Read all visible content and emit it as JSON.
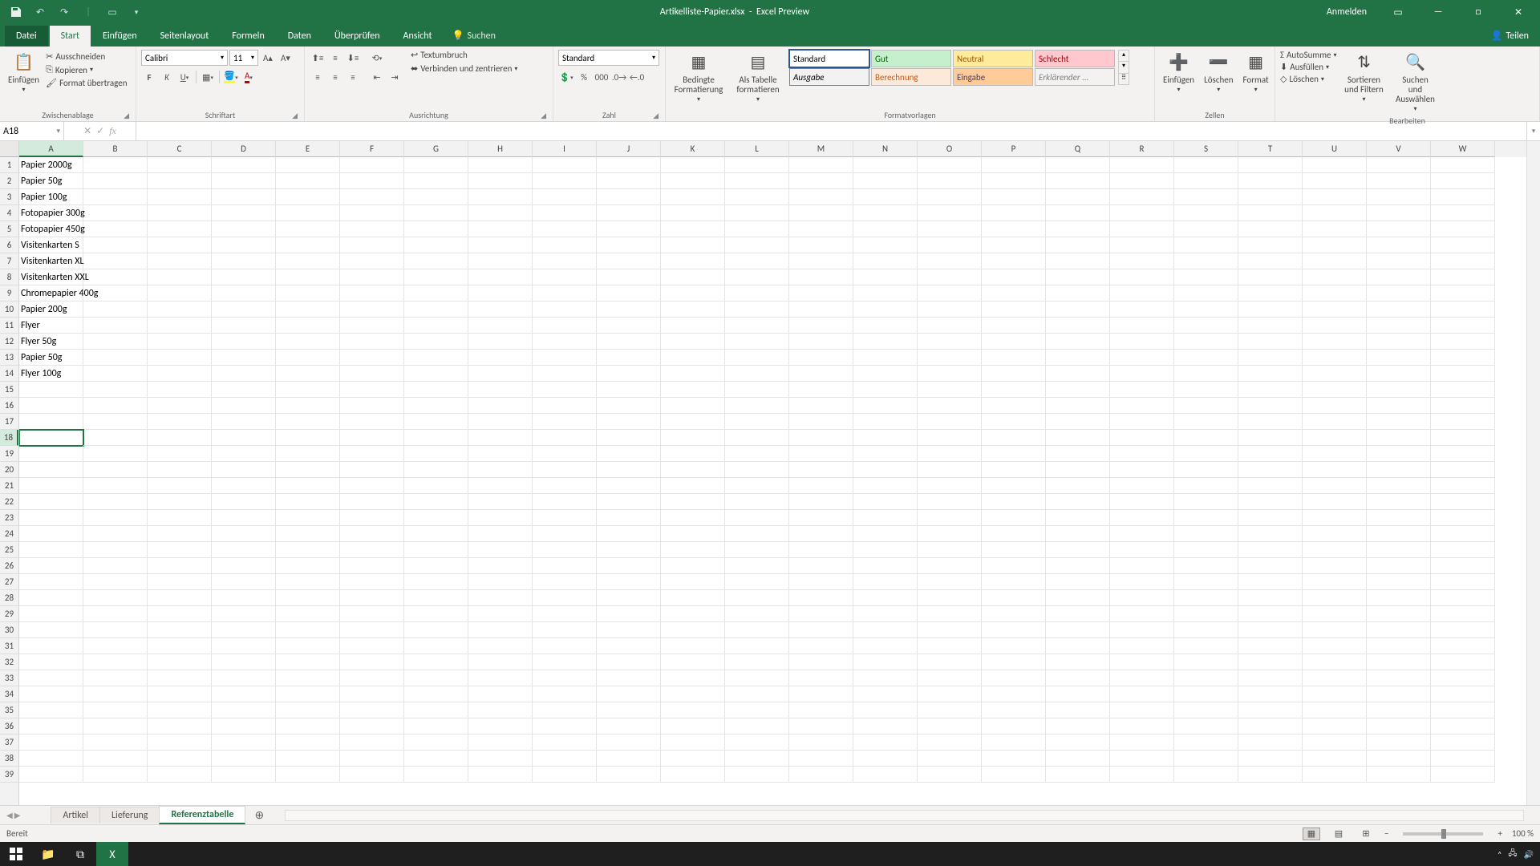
{
  "titlebar": {
    "filename": "Artikelliste-Papier.xlsx",
    "appname": "Excel Preview",
    "signin": "Anmelden"
  },
  "tabs": {
    "file": "Datei",
    "items": [
      "Start",
      "Einfügen",
      "Seitenlayout",
      "Formeln",
      "Daten",
      "Überprüfen",
      "Ansicht"
    ],
    "active_index": 0,
    "search": "Suchen",
    "share": "Teilen"
  },
  "ribbon": {
    "clipboard": {
      "paste": "Einfügen",
      "cut": "Ausschneiden",
      "copy": "Kopieren",
      "format": "Format übertragen",
      "label": "Zwischenablage"
    },
    "font": {
      "name": "Calibri",
      "size": "11",
      "label": "Schriftart"
    },
    "align": {
      "wrap": "Textumbruch",
      "merge": "Verbinden und zentrieren",
      "label": "Ausrichtung"
    },
    "number": {
      "format": "Standard",
      "label": "Zahl"
    },
    "styles": {
      "cond": "Bedingte Formatierung",
      "table": "Als Tabelle formatieren",
      "s1": "Standard",
      "s2": "Gut",
      "s3": "Neutral",
      "s4": "Schlecht",
      "s5": "Ausgabe",
      "s6": "Berechnung",
      "s7": "Eingabe",
      "s8": "Erklärender ...",
      "label": "Formatvorlagen"
    },
    "cells": {
      "insert": "Einfügen",
      "delete": "Löschen",
      "format": "Format",
      "label": "Zellen"
    },
    "editing": {
      "sum": "AutoSumme",
      "fill": "Ausfüllen",
      "clear": "Löschen",
      "sort": "Sortieren und Filtern",
      "find": "Suchen und Auswählen",
      "label": "Bearbeiten"
    }
  },
  "fxbar": {
    "namebox": "A18",
    "formula": ""
  },
  "columns": [
    "A",
    "B",
    "C",
    "D",
    "E",
    "F",
    "G",
    "H",
    "I",
    "J",
    "K",
    "L",
    "M",
    "N",
    "O",
    "P",
    "Q",
    "R",
    "S",
    "T",
    "U",
    "V",
    "W"
  ],
  "selected_col_index": 0,
  "selected_row_index": 17,
  "row_count": 39,
  "cells": {
    "A1": "Papier 2000g",
    "A2": "Papier 50g",
    "A3": "Papier 100g",
    "A4": "Fotopapier 300g",
    "A5": "Fotopapier 450g",
    "A6": "Visitenkarten S",
    "A7": "Visitenkarten XL",
    "A8": "Visitenkarten XXL",
    "A9": "Chromepapier 400g",
    "A10": "Papier 200g",
    "A11": "Flyer",
    "A12": "Flyer 50g",
    "A13": "Papier 50g",
    "A14": "Flyer 100g"
  },
  "sheets": {
    "items": [
      "Artikel",
      "Lieferung",
      "Referenztabelle"
    ],
    "active_index": 2
  },
  "statusbar": {
    "ready": "Bereit",
    "zoom": "100 %"
  }
}
